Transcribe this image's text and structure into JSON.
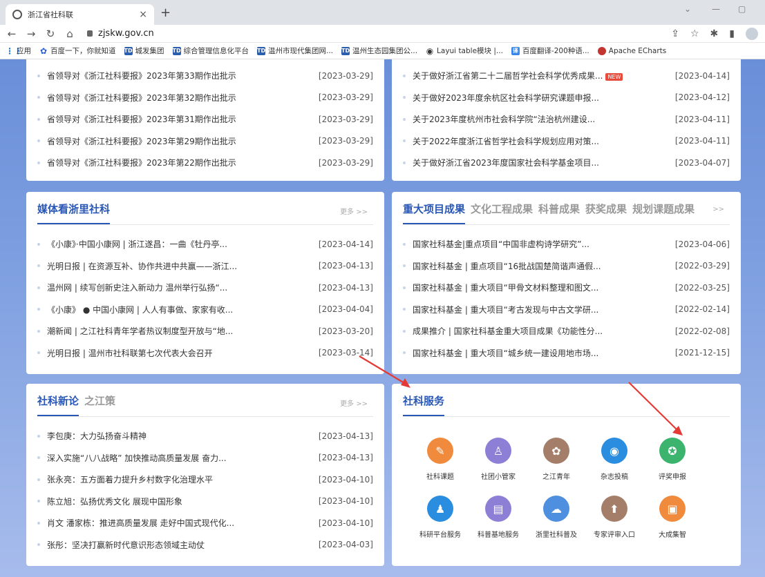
{
  "browser": {
    "tab_title": "浙江省社科联",
    "url": "zjskw.gov.cn",
    "bookmarks": [
      {
        "icon": "apps-grid-icon",
        "label": "应用"
      },
      {
        "icon": "baidu-paw-icon",
        "label": "百度一下，你就知道"
      },
      {
        "icon": "td-icon",
        "label": "城发集团"
      },
      {
        "icon": "td-icon",
        "label": "综合管理信息化平台"
      },
      {
        "icon": "td-icon",
        "label": "温州市现代集团网..."
      },
      {
        "icon": "td-icon",
        "label": "温州生态园集团公..."
      },
      {
        "icon": "globe-icon",
        "label": "Layui table模块 |..."
      },
      {
        "icon": "translate-icon",
        "label": "百度翻译-200种语..."
      },
      {
        "icon": "echarts-icon",
        "label": "Apache ECharts"
      }
    ]
  },
  "top_left": {
    "items": [
      {
        "text": "省领导对《浙江社科要报》2023年第33期作出批示",
        "date": "[2023-03-29]"
      },
      {
        "text": "省领导对《浙江社科要报》2023年第32期作出批示",
        "date": "[2023-03-29]"
      },
      {
        "text": "省领导对《浙江社科要报》2023年第31期作出批示",
        "date": "[2023-03-29]"
      },
      {
        "text": "省领导对《浙江社科要报》2023年第29期作出批示",
        "date": "[2023-03-29]"
      },
      {
        "text": "省领导对《浙江社科要报》2023年第22期作出批示",
        "date": "[2023-03-29]"
      }
    ]
  },
  "top_right": {
    "new_badge": "NEW",
    "items": [
      {
        "text": "关于做好浙江省第二十二届哲学社会科学优秀成果...",
        "date": "[2023-04-14]"
      },
      {
        "text": "关于做好2023年度余杭区社会科学研究课题申报...",
        "date": "[2023-04-12]"
      },
      {
        "text": "关于2023年度杭州市社会科学院“法治杭州建设...",
        "date": "[2023-04-11]"
      },
      {
        "text": "关于2022年度浙江省哲学社会科学规划应用对策...",
        "date": "[2023-04-11]"
      },
      {
        "text": "关于做好浙江省2023年度国家社会科学基金项目...",
        "date": "[2023-04-07]"
      }
    ]
  },
  "media": {
    "title": "媒体看浙里社科",
    "more": "更多 >>",
    "items": [
      {
        "text": "《小康》·中国小康网 | 浙江遂昌：一曲《牡丹亭...",
        "date": "[2023-04-14]"
      },
      {
        "text": "光明日报 | 在资源互补、协作共进中共赢——浙江...",
        "date": "[2023-04-13]"
      },
      {
        "text": "温州网 | 续写创新史注入新动力 温州举行弘扬“...",
        "date": "[2023-04-13]"
      },
      {
        "text": "《小康》 ● 中国小康网 | 人人有事做、家家有收...",
        "date": "[2023-04-04]"
      },
      {
        "text": "潮新闻 | 之江社科青年学者热议制度型开放与“地...",
        "date": "[2023-03-20]"
      },
      {
        "text": "光明日报 | 温州市社科联第七次代表大会召开",
        "date": "[2023-03-14]"
      }
    ]
  },
  "results": {
    "tabs": [
      "重大项目成果",
      "文化工程成果",
      "科普成果",
      "获奖成果",
      "规划课题成果"
    ],
    "more": ">>",
    "items": [
      {
        "text": "国家社科基金|重点项目“中国非虚构诗学研究”...",
        "date": "[2023-04-06]"
      },
      {
        "text": "国家社科基金 | 重点项目“16批战国楚简谐声通假...",
        "date": "[2022-03-29]"
      },
      {
        "text": "国家社科基金 | 重大项目“甲骨文材料整理和图文...",
        "date": "[2022-03-25]"
      },
      {
        "text": "国家社科基金 | 重大项目“考古发现与中古文学研...",
        "date": "[2022-02-14]"
      },
      {
        "text": "成果推介 | 国家社科基金重大项目成果《功能性分...",
        "date": "[2022-02-08]"
      },
      {
        "text": "国家社科基金 | 重大项目“城乡统一建设用地市场...",
        "date": "[2021-12-15]"
      }
    ]
  },
  "commentary": {
    "tabs": [
      "社科新论",
      "之江策"
    ],
    "more": "更多 >>",
    "items": [
      {
        "text": "李包庚：大力弘扬奋斗精神",
        "date": "[2023-04-13]"
      },
      {
        "text": "深入实施“八八战略” 加快推动高质量发展 奋力...",
        "date": "[2023-04-13]"
      },
      {
        "text": "张永亮：五方面着力提升乡村数字化治理水平",
        "date": "[2023-04-10]"
      },
      {
        "text": "陈立旭：弘扬优秀文化 展现中国形象",
        "date": "[2023-04-10]"
      },
      {
        "text": "肖文 潘家栋：推进高质量发展 走好中国式现代化...",
        "date": "[2023-04-10]"
      },
      {
        "text": "张彤：坚决打赢新时代意识形态领域主动仗",
        "date": "[2023-04-03]"
      }
    ]
  },
  "services": {
    "title": "社科服务",
    "items": [
      {
        "label": "社科课题",
        "color": "#f08a3c",
        "glyph": "✎"
      },
      {
        "label": "社团小管家",
        "color": "#8e7fd6",
        "glyph": "♙"
      },
      {
        "label": "之江青年",
        "color": "#a57e6a",
        "glyph": "✿"
      },
      {
        "label": "杂志投稿",
        "color": "#2b8de0",
        "glyph": "◉"
      },
      {
        "label": "评奖申报",
        "color": "#3cb46e",
        "glyph": "✪"
      },
      {
        "label": "科研平台服务",
        "color": "#2b8de0",
        "glyph": "♟"
      },
      {
        "label": "科普基地服务",
        "color": "#8e7fd6",
        "glyph": "▤"
      },
      {
        "label": "浙里社科普及",
        "color": "#4f8fe0",
        "glyph": "☁"
      },
      {
        "label": "专家评审入口",
        "color": "#a57e6a",
        "glyph": "⬆"
      },
      {
        "label": "大成集智",
        "color": "#f08a3c",
        "glyph": "▣"
      }
    ]
  }
}
